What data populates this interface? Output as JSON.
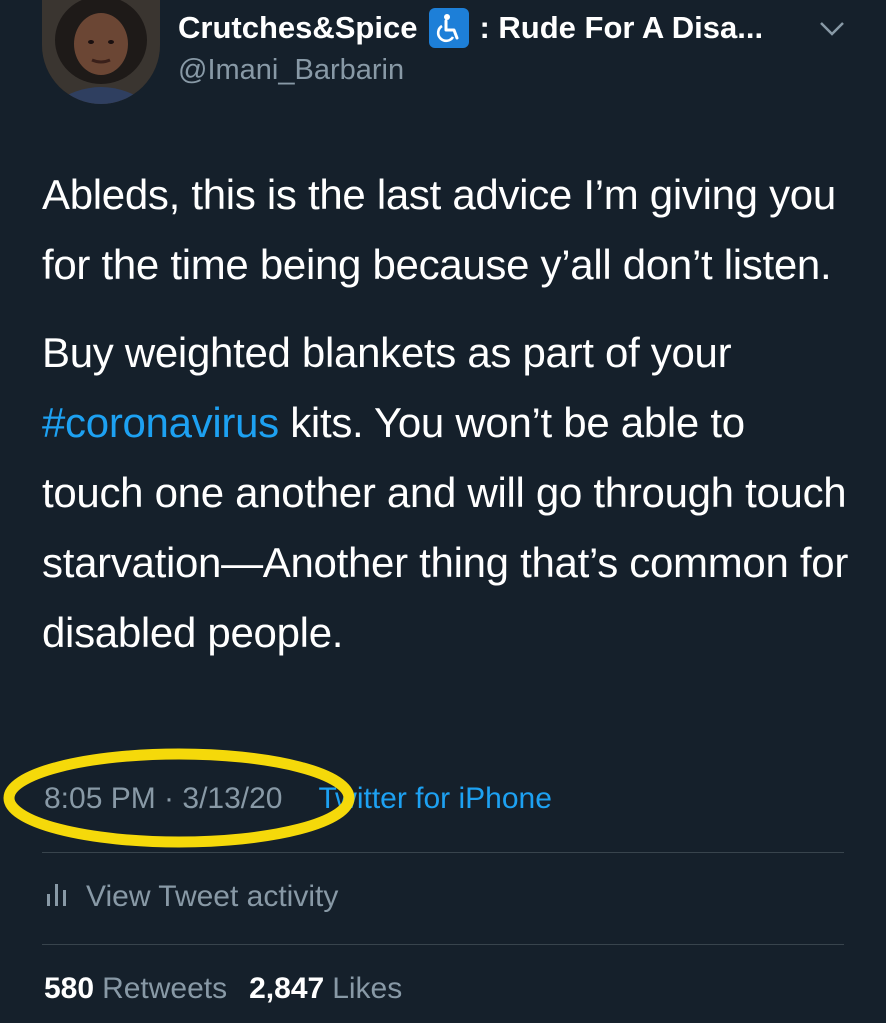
{
  "tweet": {
    "display_name": "Crutches&Spice",
    "display_name_suffix": ": Rude For A Disa...",
    "handle": "@Imani_Barbarin",
    "paragraph1": "Ableds, this is the last advice I’m giving you for the time being because y’all don’t listen.",
    "paragraph2_before": "Buy weighted blankets as part of your ",
    "hashtag": "#coronavirus",
    "paragraph2_after": " kits. You won’t be able to touch one another and will go through touch starvation—Another thing that’s common for disabled people.",
    "time": "8:05 PM · 3/13/20",
    "source": "Twitter for iPhone",
    "activity_label": "View Tweet activity",
    "retweets_count": "580",
    "retweets_label": "Retweets",
    "likes_count": "2,847",
    "likes_label": "Likes"
  },
  "icons": {
    "name_badge": "wheelchair-icon",
    "menu": "chevron-down-icon",
    "activity": "bar-chart-icon"
  },
  "colors": {
    "background": "#15202b",
    "text_primary": "#ffffff",
    "text_secondary": "#8899a6",
    "link": "#1da1f2",
    "badge": "#1d7fd8",
    "highlight_circle": "#f5d90a",
    "divider": "#38444d"
  }
}
